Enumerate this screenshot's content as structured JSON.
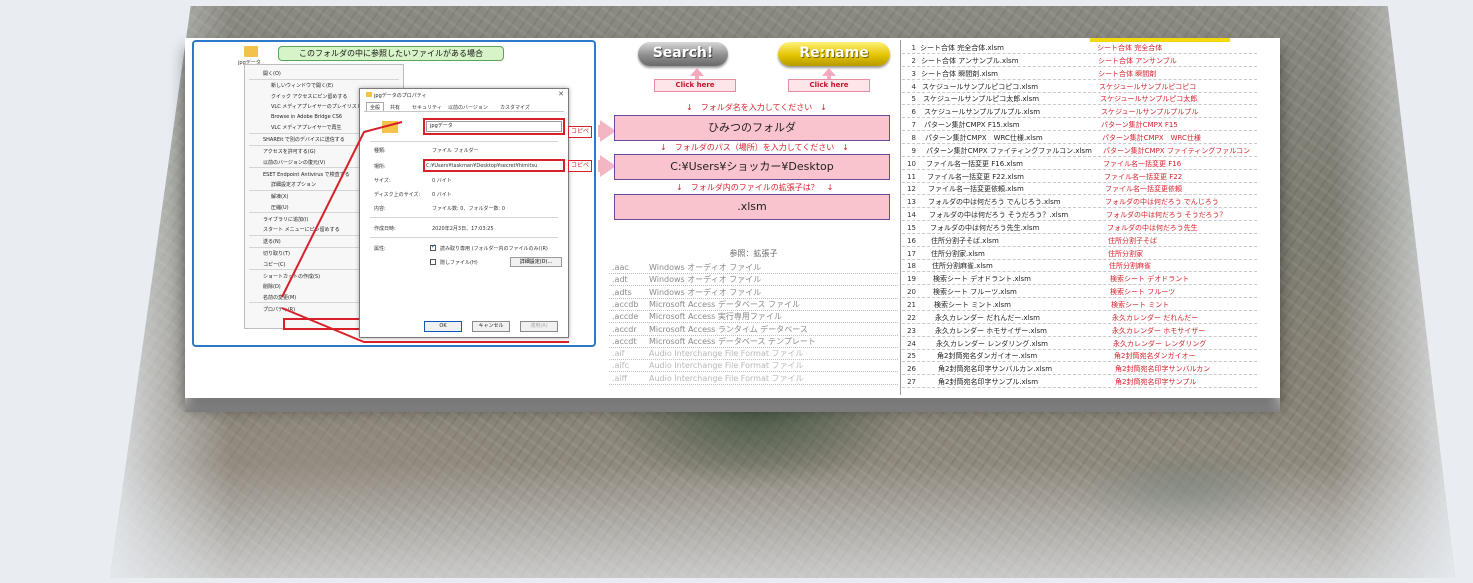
{
  "explorer": {
    "folder_label": "jpgデータ",
    "callout": "このフォルダの中に参照したいファイルがある場合",
    "context_menu": [
      {
        "label": "開く(O)",
        "indent": false
      },
      {
        "label": "新しいウィンドウで開く(E)",
        "indent": true
      },
      {
        "label": "クイック アクセスにピン留めする",
        "indent": true
      },
      {
        "label": "VLC メディアプレイヤーのプレイリストに追加",
        "indent": true
      },
      {
        "label": "Browse in Adobe Bridge CS6",
        "indent": true
      },
      {
        "label": "VLC メディアプレイヤーで再生",
        "indent": true
      },
      {
        "label": "SHAREit で別のデバイスに送信する",
        "indent": false
      },
      {
        "label": "アクセスを許可する(G)",
        "indent": false
      },
      {
        "label": "以前のバージョンの復元(V)",
        "indent": false
      },
      {
        "label": "ESET Endpoint Antivirus で検査する",
        "indent": false
      },
      {
        "label": "詳細設定オプション",
        "indent": true
      },
      {
        "label": "解凍(X)",
        "indent": true
      },
      {
        "label": "圧縮(U)",
        "indent": true
      },
      {
        "label": "ライブラリに追加(I)",
        "indent": false
      },
      {
        "label": "スタート メニューにピン留めする",
        "indent": false
      },
      {
        "label": "送る(N)",
        "indent": false
      },
      {
        "label": "切り取り(T)",
        "indent": false
      },
      {
        "label": "コピー(C)",
        "indent": false
      },
      {
        "label": "ショートカットの作成(S)",
        "indent": false
      },
      {
        "label": "削除(D)",
        "indent": false
      },
      {
        "label": "名前の変更(M)",
        "indent": false
      },
      {
        "label": "プロパティ(R)",
        "indent": false
      }
    ]
  },
  "properties_dialog": {
    "title": "jpgデータのプロパティ",
    "close": "✕",
    "tabs": [
      "全般",
      "共有",
      "セキュリティ",
      "以前のバージョン",
      "カスタマイズ"
    ],
    "name": "jpgデータ",
    "rows": [
      {
        "label": "種類:",
        "value": "ファイル フォルダー"
      },
      {
        "label": "場所:",
        "value": "C:¥Users¥taskman¥Desktop¥secret¥himitsu"
      },
      {
        "label": "サイズ:",
        "value": "0 バイト"
      },
      {
        "label": "ディスク上のサイズ:",
        "value": "0 バイト"
      },
      {
        "label": "内容:",
        "value": "ファイル数: 0、フォルダー数: 0"
      },
      {
        "label": "作成日時:",
        "value": "2020年2月3日、17:03:25"
      },
      {
        "label": "属性:",
        "value": ""
      }
    ],
    "attr_readonly": "読み取り専用 (フォルダー内のファイルのみ)(R)",
    "attr_hidden": "隠しファイル(H)",
    "advanced_button": "詳細設定(D)...",
    "ok": "OK",
    "cancel": "キャンセル",
    "apply": "適用(A)"
  },
  "copy_tag": "コピペ",
  "controls": {
    "search_label": "Search!",
    "rename_label": "Re:name",
    "click_here": "Click here",
    "prompt_folder": "↓　フォルダ名を入力してください　↓",
    "folder_value": "ひみつのフォルダ",
    "prompt_path": "↓　フォルダのパス（場所）を入力してください　↓",
    "path_value": "C:¥Users¥ショッカー¥Desktop",
    "prompt_ext": "↓　フォルダ内のファイルの拡張子は？　↓",
    "ext_value": ".xlsm"
  },
  "extensions": {
    "title": "参照：拡張子",
    "rows": [
      {
        "ext": ".aac",
        "desc": "Windows オーディオ ファイル"
      },
      {
        "ext": ".adt",
        "desc": "Windows オーディオ ファイル"
      },
      {
        "ext": ".adts",
        "desc": "Windows オーディオ ファイル"
      },
      {
        "ext": ".accdb",
        "desc": "Microsoft Access データベース ファイル"
      },
      {
        "ext": ".accde",
        "desc": "Microsoft Access 実行専用ファイル"
      },
      {
        "ext": ".accdr",
        "desc": "Microsoft Access ランタイム データベース"
      },
      {
        "ext": ".accdt",
        "desc": "Microsoft Access データベース テンプレート"
      },
      {
        "ext": ".aif",
        "desc": "Audio Interchange File Format ファイル"
      },
      {
        "ext": ".aifc",
        "desc": "Audio Interchange File Format ファイル"
      },
      {
        "ext": ".aiff",
        "desc": "Audio Interchange File Format ファイル"
      }
    ]
  },
  "file_list": [
    {
      "n": "1",
      "file": "シート合体 完全合体.xlsm",
      "name": "シート合体 完全合体"
    },
    {
      "n": "2",
      "file": "シート合体 アンサンブル.xlsm",
      "name": "シート合体 アンサンブル"
    },
    {
      "n": "3",
      "file": "シート合体 瞬間剤.xlsm",
      "name": "シート合体 瞬間剤"
    },
    {
      "n": "4",
      "file": "スケジュールサンプルピコピコ.xlsm",
      "name": "スケジュールサンプルピコピコ"
    },
    {
      "n": "5",
      "file": "スケジュールサンプルピコ太郎.xlsm",
      "name": "スケジュールサンプルピコ太郎"
    },
    {
      "n": "6",
      "file": "スケジュールサンプルプルプル.xlsm",
      "name": "スケジュールサンプルプルプル"
    },
    {
      "n": "7",
      "file": "パターン集計CMPX F15.xlsm",
      "name": "パターン集計CMPX F15"
    },
    {
      "n": "8",
      "file": "パターン集計CMPX　WRC仕様.xlsm",
      "name": "パターン集計CMPX　WRC仕様"
    },
    {
      "n": "9",
      "file": "パターン集計CMPX ファイティングファルコン.xlsm",
      "name": "パターン集計CMPX ファイティングファルコン"
    },
    {
      "n": "10",
      "file": "ファイル名一括変更 F16.xlsm",
      "name": "ファイル名一括変更 F16"
    },
    {
      "n": "11",
      "file": "ファイル名一括変更 F22.xlsm",
      "name": "ファイル名一括変更 F22"
    },
    {
      "n": "12",
      "file": "ファイル名一括変更依頼.xlsm",
      "name": "ファイル名一括変更依頼"
    },
    {
      "n": "13",
      "file": "フォルダの中は何だろう でんじろう.xlsm",
      "name": "フォルダの中は何だろう でんじろう"
    },
    {
      "n": "14",
      "file": "フォルダの中は何だろう そうだろう？.xlsm",
      "name": "フォルダの中は何だろう そうだろう？"
    },
    {
      "n": "15",
      "file": "フォルダの中は何だろう先生.xlsm",
      "name": "フォルダの中は何だろう先生"
    },
    {
      "n": "16",
      "file": "住所分割子そば.xlsm",
      "name": "住所分割子そば"
    },
    {
      "n": "17",
      "file": "住所分割家.xlsm",
      "name": "住所分割家"
    },
    {
      "n": "18",
      "file": "住所分割麻雀.xlsm",
      "name": "住所分割麻雀"
    },
    {
      "n": "19",
      "file": "検索シート デオドラント.xlsm",
      "name": "検索シート デオドラント"
    },
    {
      "n": "20",
      "file": "検索シート フルーツ.xlsm",
      "name": "検索シート フルーツ"
    },
    {
      "n": "21",
      "file": "検索シート ミント.xlsm",
      "name": "検索シート ミント"
    },
    {
      "n": "22",
      "file": "永久カレンダー だれんだー.xlsm",
      "name": "永久カレンダー だれんだー"
    },
    {
      "n": "23",
      "file": "永久カレンダー ホモサイザー.xlsm",
      "name": "永久カレンダー ホモサイザー"
    },
    {
      "n": "24",
      "file": "永久カレンダー レンダリング.xlsm",
      "name": "永久カレンダー レンダリング"
    },
    {
      "n": "25",
      "file": "角2封筒宛名ダンガイオー.xlsm",
      "name": "角2封筒宛名ダンガイオー"
    },
    {
      "n": "26",
      "file": "角2封筒宛名印字サンバルカン.xlsm",
      "name": "角2封筒宛名印字サンバルカン"
    },
    {
      "n": "27",
      "file": "角2封筒宛名印字サンプル.xlsm",
      "name": "角2封筒宛名印字サンプル"
    }
  ],
  "colors": {
    "accent_red": "#d8202a",
    "field_pink": "#f9c4cd",
    "frame_blue": "#2e79c7"
  }
}
